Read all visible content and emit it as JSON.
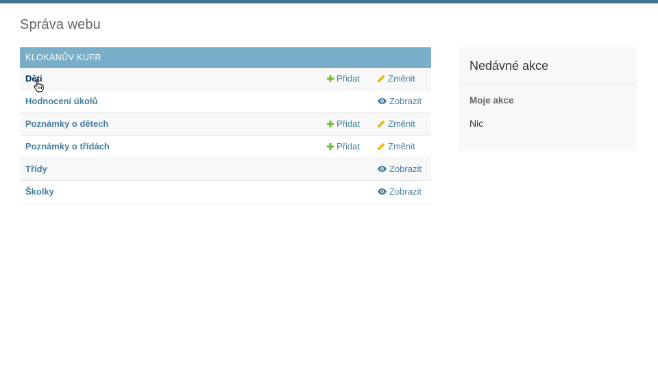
{
  "header": {
    "title": "Správa webu"
  },
  "app_module": {
    "caption": "Klokanův kufr",
    "models": [
      {
        "name": "Děti",
        "add_label": "Přidat",
        "change_label": "Změnit"
      },
      {
        "name": "Hodnocení úkolů",
        "view_label": "Zobrazit"
      },
      {
        "name": "Poznámky o dětech",
        "add_label": "Přidat",
        "change_label": "Změnit"
      },
      {
        "name": "Poznámky o třídách",
        "add_label": "Přidat",
        "change_label": "Změnit"
      },
      {
        "name": "Třídy",
        "view_label": "Zobrazit"
      },
      {
        "name": "Školky",
        "view_label": "Zobrazit"
      }
    ]
  },
  "recent_actions": {
    "title": "Nedávné akce",
    "subtitle": "Moje akce",
    "empty_text": "Nic"
  },
  "icons": {
    "add": "plus-icon",
    "change": "pencil-icon",
    "view": "eye-icon",
    "cursor": "hand-pointer-cursor-icon"
  },
  "colors": {
    "header_bar": "#417690",
    "caption_bg": "#79aec8",
    "link": "#447e9b",
    "add_icon": "#70bf2b",
    "change_icon": "#efb80b"
  }
}
